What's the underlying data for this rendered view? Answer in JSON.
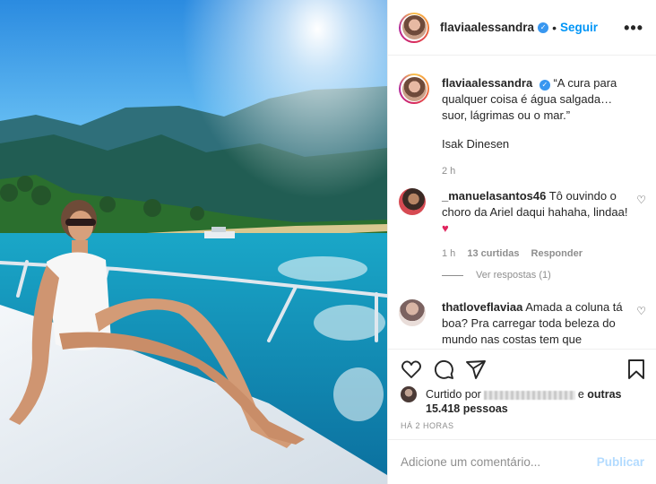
{
  "post": {
    "username": "flaviaalessandra",
    "follow_label": "Seguir",
    "more_label": "•••",
    "dot": "•",
    "verified_mark": "✓"
  },
  "caption": {
    "username": "flaviaalessandra",
    "text": "“A cura para qualquer coisa é água salgada… suor, lágrimas ou o mar.”",
    "author": "Isak Dinesen",
    "time": "2 h"
  },
  "comments": [
    {
      "username": "_manuelasantos46",
      "text": "Tô ouvindo o choro da Ariel daqui hahaha, lindaa!",
      "emoji": "♥",
      "time": "1 h",
      "likes": "13 curtidas",
      "reply_label": "Responder",
      "view_replies": "Ver respostas (1)"
    },
    {
      "username": "thatloveflaviaa",
      "text": "Amada a coluna tá boa? Pra carregar toda beleza do mundo nas costas tem que"
    }
  ],
  "likes": {
    "prefix": "Curtido por",
    "connector": "e",
    "others": "outras 15.418 pessoas"
  },
  "timestamp": "HÁ 2 HORAS",
  "comment_box": {
    "placeholder": "Adicione um comentário...",
    "publish_label": "Publicar"
  },
  "icons": {
    "small_heart": "♡"
  },
  "colors": {
    "link_blue": "#0095f6",
    "verified_blue": "#3897f0",
    "publish_disabled": "#b3dbff",
    "muted_text": "#8e8e8e"
  }
}
